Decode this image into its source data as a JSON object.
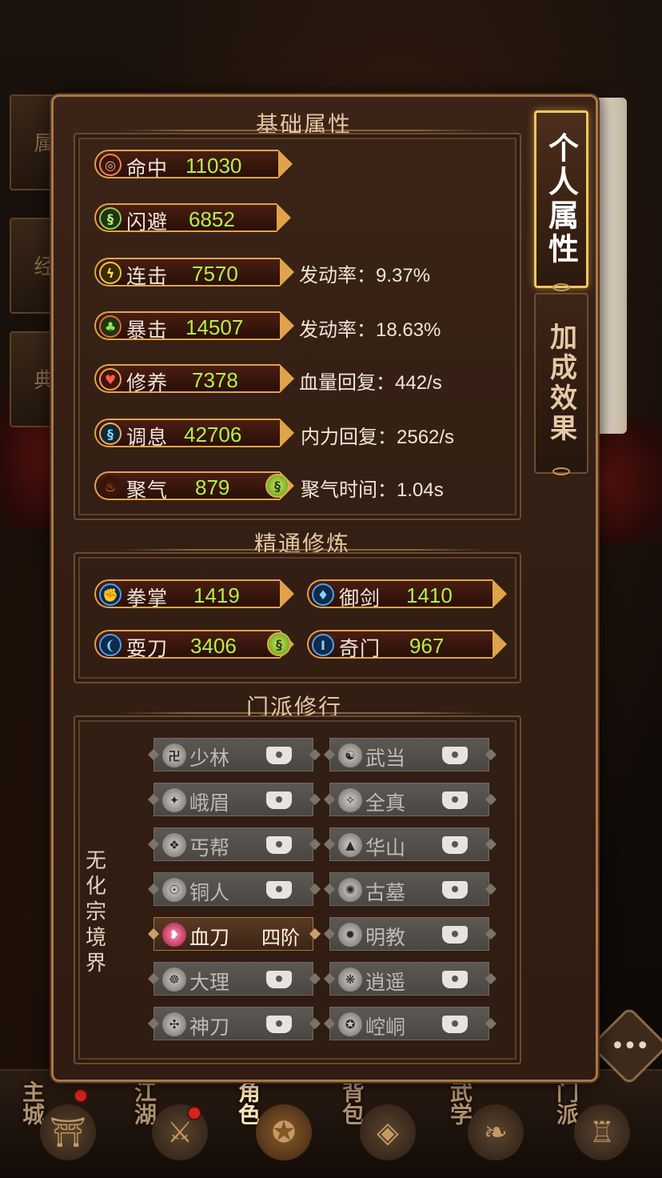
{
  "background": {
    "side_tabs": [
      "属",
      "经",
      "典"
    ],
    "bottom_nav": [
      {
        "label": "主城",
        "icon": "palace-icon",
        "dot": true
      },
      {
        "label": "江湖",
        "icon": "sword-icon",
        "dot": false
      },
      {
        "label": "角色",
        "icon": "character-icon",
        "dot": true,
        "active": true
      },
      {
        "label": "背包",
        "icon": "bag-icon",
        "dot": false
      },
      {
        "label": "武学",
        "icon": "scroll-icon",
        "dot": false
      },
      {
        "label": "门派",
        "icon": "cauldron-icon",
        "dot": false
      }
    ]
  },
  "tabs": {
    "personal": "个人属性",
    "bonus": "加成效果"
  },
  "basic": {
    "title": "基础属性",
    "stats": [
      {
        "icon": "target-icon",
        "glyph": "◎",
        "name": "命中",
        "value": "11030",
        "extra_label": "",
        "extra_value": ""
      },
      {
        "icon": "dodge-icon",
        "glyph": "§",
        "name": "闪避",
        "value": "6852",
        "extra_label": "",
        "extra_value": ""
      },
      {
        "icon": "lightning-icon",
        "glyph": "ϟ",
        "name": "连击",
        "value": "7570",
        "extra_label": "发动率：",
        "extra_value": "9.37%"
      },
      {
        "icon": "crit-icon",
        "glyph": "♣",
        "name": "暴击",
        "value": "14507",
        "extra_label": "发动率：",
        "extra_value": "18.63%"
      },
      {
        "icon": "heart-icon",
        "glyph": "♥",
        "name": "修养",
        "value": "7378",
        "extra_label": "血量回复：",
        "extra_value": "442/s"
      },
      {
        "icon": "breath-icon",
        "glyph": "§",
        "name": "调息",
        "value": "42706",
        "extra_label": "内力回复：",
        "extra_value": "2562/s"
      },
      {
        "icon": "fire-icon",
        "glyph": "♨",
        "name": "聚气",
        "value": "879",
        "extra_label": "聚气时间：",
        "extra_value": "1.04s"
      }
    ]
  },
  "mastery": {
    "title": "精通修炼",
    "items": [
      {
        "icon": "fist-icon",
        "glyph": "✊",
        "name": "拳掌",
        "value": "1419",
        "badge": false
      },
      {
        "icon": "sword-mastery-icon",
        "glyph": "♦",
        "name": "御剑",
        "value": "1410",
        "badge": false
      },
      {
        "icon": "blade-icon",
        "glyph": "❨",
        "name": "耍刀",
        "value": "3406",
        "badge": true
      },
      {
        "icon": "rod-icon",
        "glyph": "I",
        "name": "奇门",
        "value": "967",
        "badge": false
      }
    ]
  },
  "sect": {
    "title": "门派修行",
    "realm_label": "无化宗境界",
    "left": [
      {
        "name": "少林",
        "icon": "shaolin-icon",
        "glyph": "卍",
        "level": "",
        "locked": true
      },
      {
        "name": "峨眉",
        "icon": "emei-icon",
        "glyph": "✦",
        "level": "",
        "locked": true
      },
      {
        "name": "丐帮",
        "icon": "beggar-icon",
        "glyph": "❖",
        "level": "",
        "locked": true
      },
      {
        "name": "铜人",
        "icon": "bronze-icon",
        "glyph": "☉",
        "level": "",
        "locked": true
      },
      {
        "name": "血刀",
        "icon": "blood-blade-icon",
        "glyph": "❥",
        "level": "四阶",
        "locked": false,
        "active": true
      },
      {
        "name": "大理",
        "icon": "dali-icon",
        "glyph": "☸",
        "level": "",
        "locked": true
      },
      {
        "name": "神刀",
        "icon": "divine-blade-icon",
        "glyph": "✣",
        "level": "",
        "locked": true
      }
    ],
    "right": [
      {
        "name": "武当",
        "icon": "wudang-icon",
        "glyph": "☯",
        "level": "",
        "locked": true
      },
      {
        "name": "全真",
        "icon": "quanzhen-icon",
        "glyph": "✧",
        "level": "",
        "locked": true
      },
      {
        "name": "华山",
        "icon": "huashan-icon",
        "glyph": "▲",
        "level": "",
        "locked": true
      },
      {
        "name": "古墓",
        "icon": "tomb-icon",
        "glyph": "✺",
        "level": "",
        "locked": true
      },
      {
        "name": "明教",
        "icon": "mingjiao-icon",
        "glyph": "✹",
        "level": "",
        "locked": true
      },
      {
        "name": "逍遥",
        "icon": "xiaoyao-icon",
        "glyph": "❋",
        "level": "",
        "locked": true
      },
      {
        "name": "崆峒",
        "icon": "kongtong-icon",
        "glyph": "✪",
        "level": "",
        "locked": true
      }
    ]
  },
  "colors": {
    "accent_gold": "#e0a34c",
    "value_green": "#b4f04a",
    "tab_active_border": "#f1c85a"
  }
}
